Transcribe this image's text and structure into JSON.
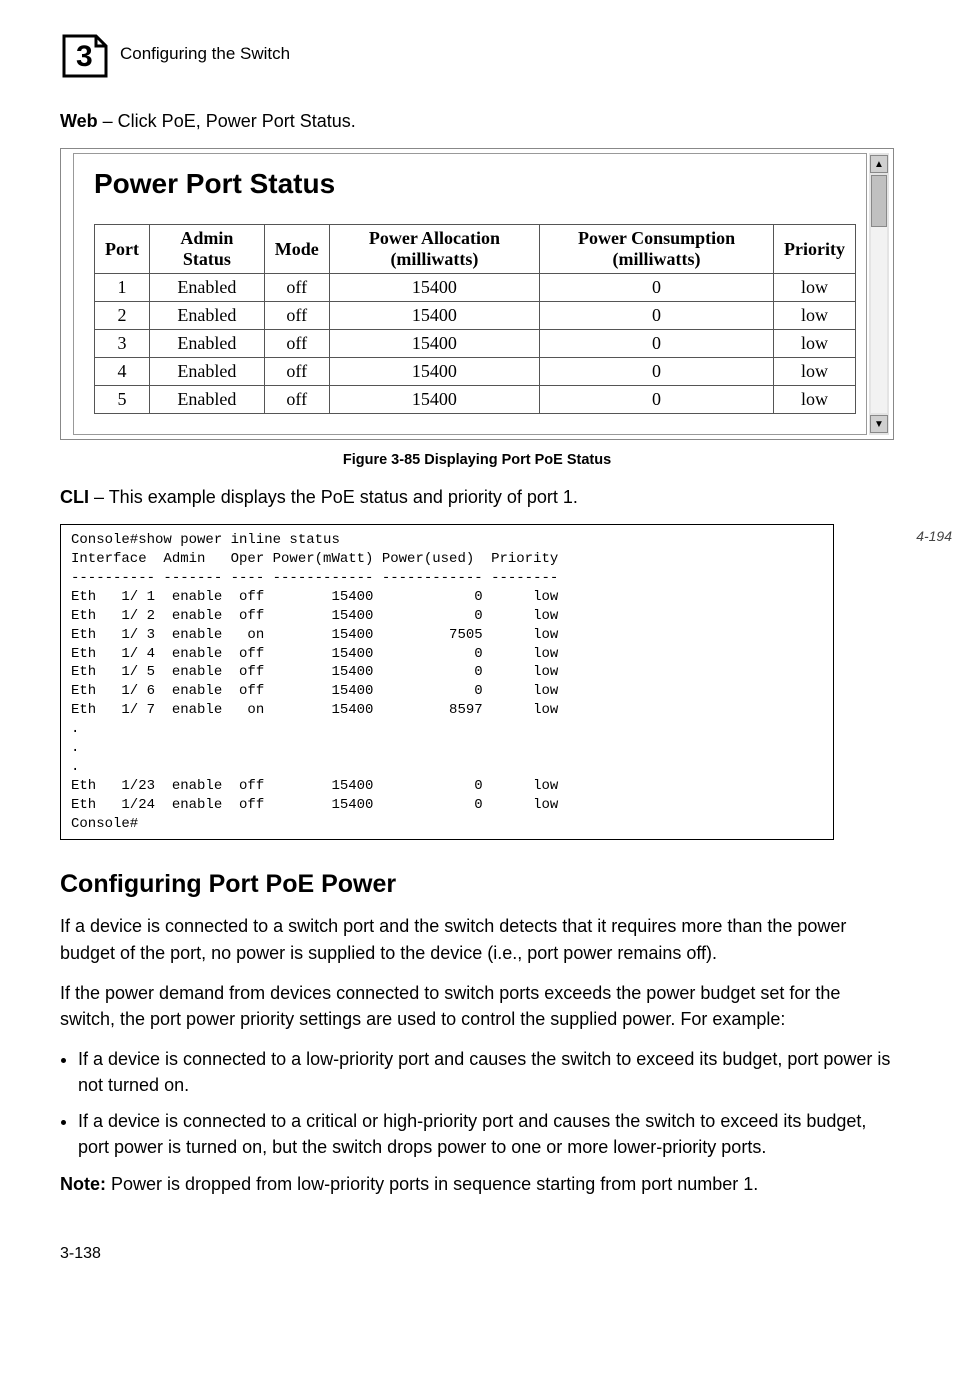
{
  "header": {
    "chapter_number": "3",
    "section": "Configuring the Switch"
  },
  "intro": {
    "web_line_prefix": "Web",
    "web_line_rest": " – Click PoE, Power Port Status."
  },
  "panel": {
    "title": "Power Port Status",
    "columns": {
      "port": "Port",
      "admin": "Admin Status",
      "mode": "Mode",
      "alloc": "Power Allocation (milliwatts)",
      "cons": "Power Consumption (milliwatts)",
      "prio": "Priority"
    },
    "rows": [
      {
        "port": "1",
        "admin": "Enabled",
        "mode": "off",
        "alloc": "15400",
        "cons": "0",
        "prio": "low"
      },
      {
        "port": "2",
        "admin": "Enabled",
        "mode": "off",
        "alloc": "15400",
        "cons": "0",
        "prio": "low"
      },
      {
        "port": "3",
        "admin": "Enabled",
        "mode": "off",
        "alloc": "15400",
        "cons": "0",
        "prio": "low"
      },
      {
        "port": "4",
        "admin": "Enabled",
        "mode": "off",
        "alloc": "15400",
        "cons": "0",
        "prio": "low"
      },
      {
        "port": "5",
        "admin": "Enabled",
        "mode": "off",
        "alloc": "15400",
        "cons": "0",
        "prio": "low"
      }
    ]
  },
  "figure_caption": "Figure 3-85  Displaying Port PoE Status",
  "cli_intro_prefix": "CLI",
  "cli_intro_rest": " – This example displays the PoE status and priority of port 1.",
  "cli_ref": "4-194",
  "cli_text": "Console#show power inline status\nInterface  Admin   Oper Power(mWatt) Power(used)  Priority\n---------- ------- ---- ------------ ------------ --------\nEth   1/ 1  enable  off        15400            0      low\nEth   1/ 2  enable  off        15400            0      low\nEth   1/ 3  enable   on        15400         7505      low\nEth   1/ 4  enable  off        15400            0      low\nEth   1/ 5  enable  off        15400            0      low\nEth   1/ 6  enable  off        15400            0      low\nEth   1/ 7  enable   on        15400         8597      low\n.\n.\n.\nEth   1/23  enable  off        15400            0      low\nEth   1/24  enable  off        15400            0      low\nConsole#",
  "heading2": "Configuring Port PoE Power",
  "para1": "If a device is connected to a switch port and the switch detects that it requires more than the power budget of the port, no power is supplied to the device (i.e., port power remains off).",
  "para2": "If the power demand from devices connected to switch ports exceeds the power budget set for the switch, the port power priority settings are used to control the supplied power. For example:",
  "bullets": [
    "If a device is connected to a low-priority port and causes the switch to exceed its budget, port power is not turned on.",
    "If a device is connected to a critical or high-priority port and causes the switch to exceed its budget, port power is turned on, but the switch drops power to one or more lower-priority ports."
  ],
  "note_label": "Note:",
  "note_text": " Power is dropped from low-priority ports in sequence starting from port number 1.",
  "footer": "3-138"
}
